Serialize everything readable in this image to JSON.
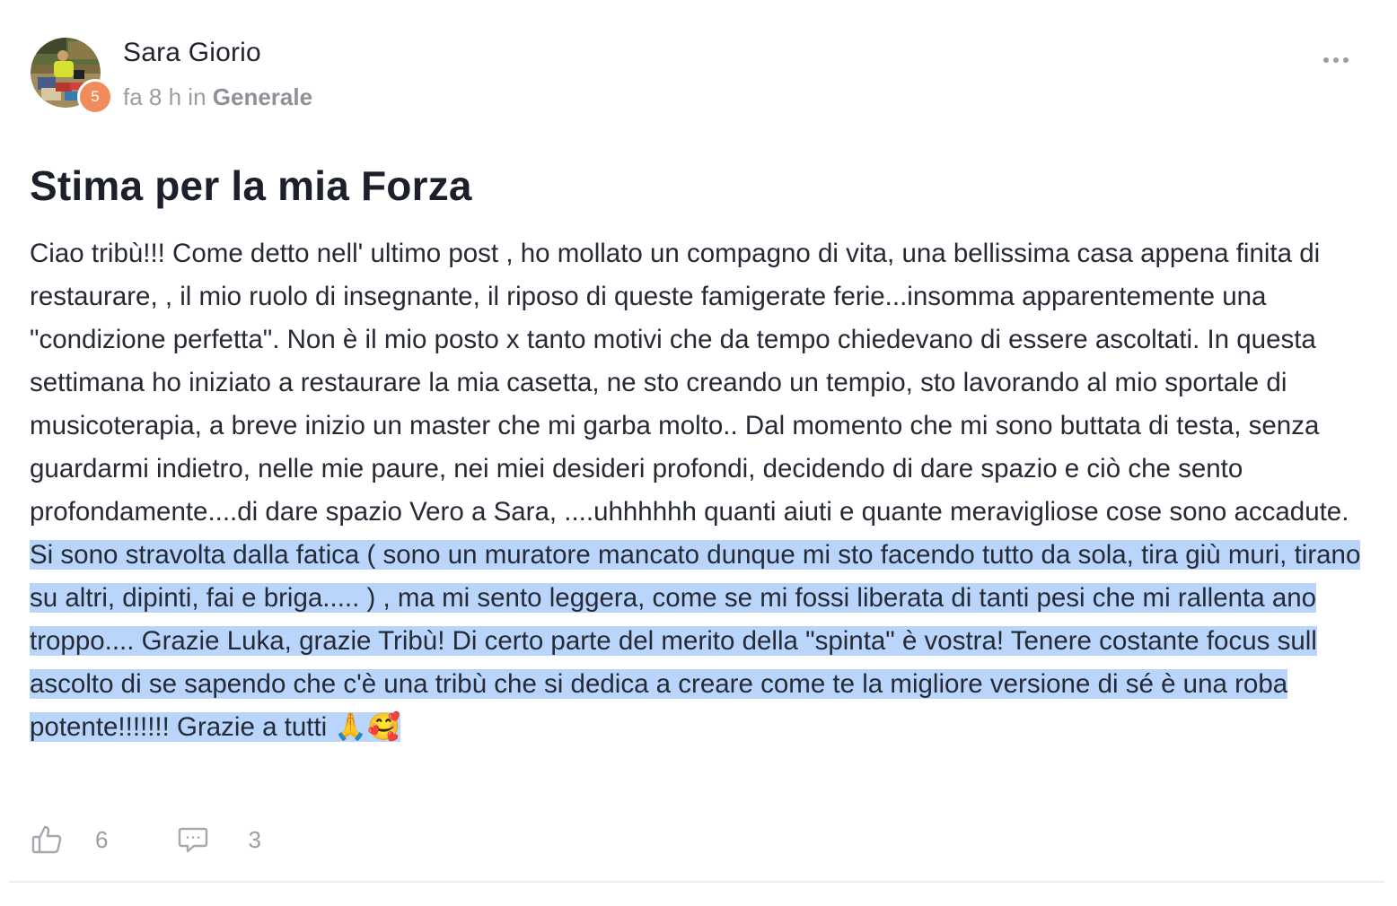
{
  "post": {
    "author": {
      "name": "Sara Giorio",
      "level": "5",
      "avatar_icon": "user-photo"
    },
    "meta": {
      "time": "fa 8 h",
      "in_label": "in",
      "category": "Generale"
    },
    "title": "Stima per la mia Forza",
    "body": {
      "text": "Ciao tribù!!! Come detto nell' ultimo post , ho mollato un compagno di vita, una bellissima casa appena finita di restaurare, , il mio ruolo di insegnante, il riposo di queste famigerate ferie...insomma apparentemente una \"condizione perfetta\". Non è il mio posto x tanto motivi che da tempo chiedevano di essere ascoltati. In questa settimana ho iniziato a restaurare la mia casetta, ne sto creando un tempio, sto lavorando al mio sportale di musicoterapia, a breve inizio un master che mi garba molto.. Dal momento che mi sono buttata di testa, senza guardarmi indietro, nelle mie paure, nei miei desideri profondi, decidendo di dare spazio e ciò che sento profondamente....di dare spazio Vero a Sara, ....uhhhhhh quanti aiuti e quante meravigliose cose sono accadute. ",
      "selected_text": "Si sono stravolta dalla fatica ( sono un muratore mancato dunque mi sto facendo tutto da sola, tira giù muri, tirano su altri, dipinti, fai e briga..... ) , ma mi sento leggera, come se mi fossi liberata di tanti pesi che mi rallenta ano troppo.... Grazie Luka, grazie Tribù! Di certo parte del merito della \"spinta\" è vostra! Tenere costante focus sull ascolto di se sapendo che c'è una tribù che si dedica a creare come te la migliore versione di sé è una roba potente!!!!!!! Grazie a tutti 🙏🥰"
    },
    "actions": {
      "likes": "6",
      "comments": "3"
    }
  },
  "colors": {
    "selection": "#b9d5fb",
    "badge": "#f28b5c",
    "muted": "#9a9da4",
    "text": "#1f2430"
  },
  "icons": {
    "like": "thumbs-up-icon",
    "comment": "comment-bubble-icon",
    "more": "more-horizontal-icon"
  }
}
